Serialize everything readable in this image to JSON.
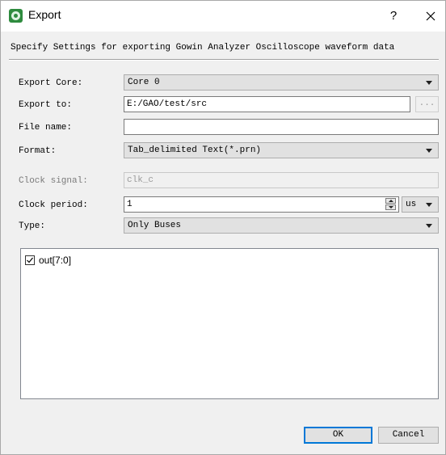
{
  "window": {
    "title": "Export",
    "help_label": "?"
  },
  "description": "Specify Settings for exporting Gowin Analyzer Oscilloscope waveform data",
  "form": {
    "export_core": {
      "label": "Export Core:",
      "value": "Core 0"
    },
    "export_to": {
      "label": "Export to:",
      "value": "E:/GAO/test/src",
      "browse_label": "..."
    },
    "file_name": {
      "label": "File name:",
      "value": ""
    },
    "format": {
      "label": "Format:",
      "value": "Tab_delimited Text(*.prn)"
    },
    "clock_signal": {
      "label": "Clock signal:",
      "value": "clk_c"
    },
    "clock_period": {
      "label": "Clock period:",
      "value": "1",
      "unit": "us"
    },
    "type": {
      "label": "Type:",
      "value": "Only Buses"
    }
  },
  "signals": [
    {
      "label": "out[7:0]",
      "checked": true
    }
  ],
  "buttons": {
    "ok": "OK",
    "cancel": "Cancel"
  },
  "icons": {
    "app": "gowin-analyzer-app-icon",
    "close": "close-icon",
    "dropdown": "chevron-down-icon",
    "check": "checkmark-icon"
  }
}
